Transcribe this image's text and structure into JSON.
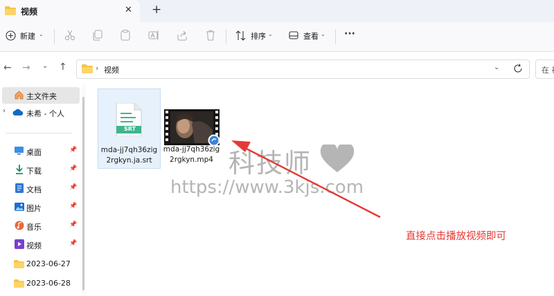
{
  "tab": {
    "title": "视频",
    "close_glyph": "✕",
    "add_glyph": "+"
  },
  "toolbar": {
    "new_label": "新建",
    "sort_label": "排序",
    "view_label": "查看",
    "more_label": "···"
  },
  "address": {
    "path": [
      "视频"
    ],
    "separator": "›",
    "search_placeholder": "在 视"
  },
  "sidebar": {
    "items": [
      {
        "label": "主文件夹",
        "icon": "home-icon"
      },
      {
        "label": "未希 - 个人",
        "icon": "cloud-icon"
      },
      {
        "label": "桌面",
        "icon": "desktop-icon",
        "pinned": true
      },
      {
        "label": "下载",
        "icon": "download-icon",
        "pinned": true
      },
      {
        "label": "文档",
        "icon": "document-icon",
        "pinned": true
      },
      {
        "label": "图片",
        "icon": "picture-icon",
        "pinned": true
      },
      {
        "label": "音乐",
        "icon": "music-icon",
        "pinned": true
      },
      {
        "label": "视频",
        "icon": "video-icon",
        "pinned": true
      },
      {
        "label": "2023-06-27",
        "icon": "folder-icon"
      },
      {
        "label": "2023-06-28",
        "icon": "folder-icon"
      }
    ]
  },
  "files": [
    {
      "name_line1": "mda-jj7qh36zig",
      "name_line2": "2rgkyn.ja.srt",
      "badge": "SRT",
      "type": "subtitle"
    },
    {
      "name_line1": "mda-jj7qh36zig",
      "name_line2": "2rgkyn.mp4",
      "type": "video"
    }
  ],
  "watermark": {
    "brand": "科技师",
    "url": "https://www.3kjs.com"
  },
  "annotation": {
    "text": "直接点击播放视频即可"
  },
  "colors": {
    "accent": "#0067c0",
    "annotation_red": "#e53935",
    "folder_yellow": "#f7c244",
    "srt_green": "#3fb58e"
  }
}
